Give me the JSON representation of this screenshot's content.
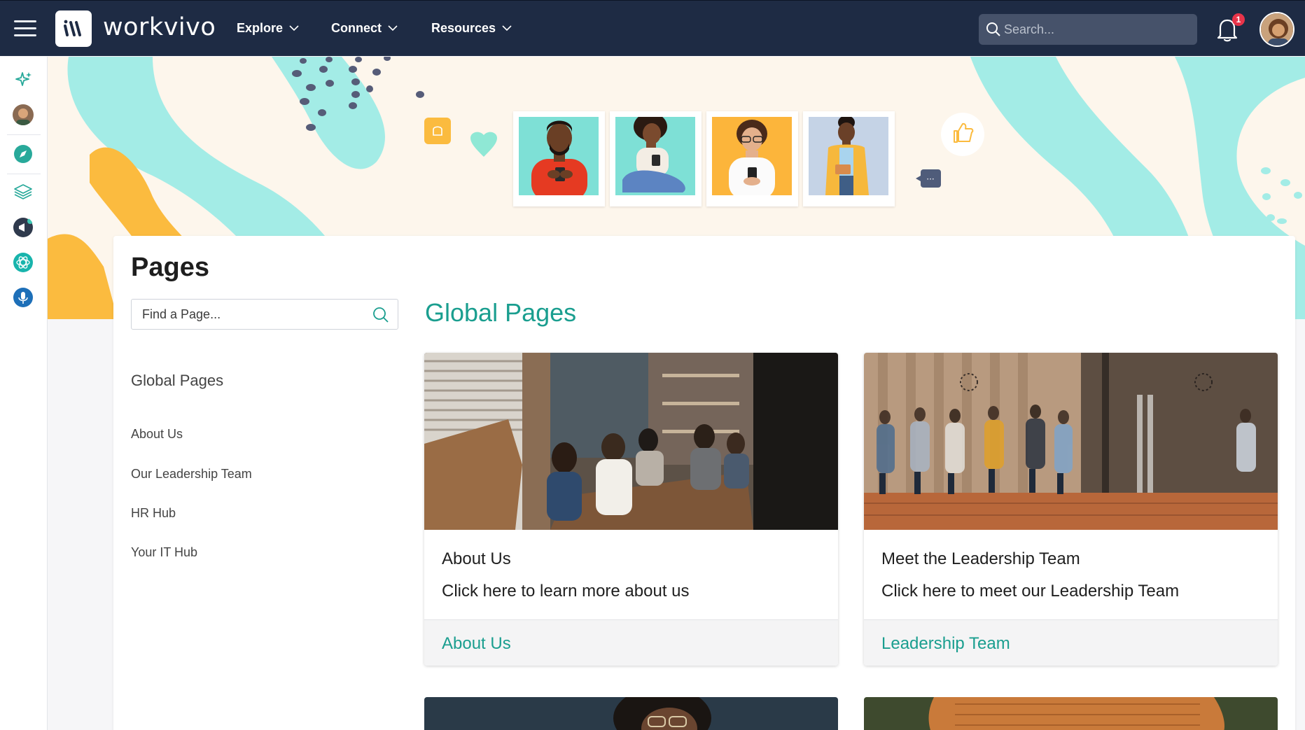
{
  "app": {
    "name": "workvivo"
  },
  "nav": {
    "items": [
      {
        "label": "Explore"
      },
      {
        "label": "Connect"
      },
      {
        "label": "Resources"
      }
    ],
    "search_placeholder": "Search...",
    "notification_count": "1"
  },
  "rail": {
    "icons": [
      "sparkles-icon",
      "user-avatar",
      "compass-icon",
      "layers-icon",
      "megaphone-icon",
      "atom-icon",
      "microphone-icon"
    ]
  },
  "page": {
    "title": "Pages",
    "find_placeholder": "Find a Page...",
    "sidebar": {
      "heading": "Global Pages",
      "links": [
        "About Us",
        "Our Leadership Team",
        "HR Hub",
        "Your IT Hub"
      ]
    },
    "section_title": "Global Pages",
    "cards": [
      {
        "title": "About Us",
        "description": "Click here to learn more about us",
        "link": "About Us"
      },
      {
        "title": "Meet the Leadership Team",
        "description": "Click here to meet our Leadership Team",
        "link": "Leadership Team"
      }
    ]
  },
  "colors": {
    "topbar": "#1e2b44",
    "accent": "#1a9e8f",
    "banner_mint": "#a3ece6",
    "banner_yellow": "#fbbb3f",
    "badge": "#e8344a"
  }
}
